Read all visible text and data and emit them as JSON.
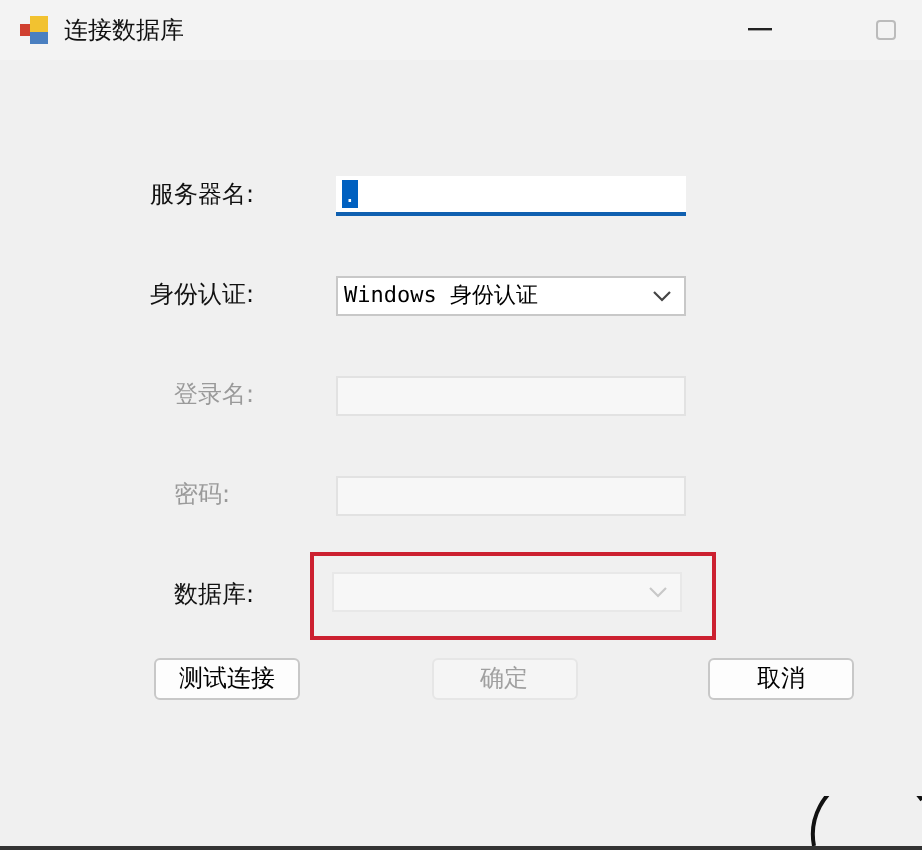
{
  "window": {
    "title": "连接数据库"
  },
  "fields": [
    {
      "label": "服务器名:",
      "label_greyed": false,
      "kind": "text",
      "value": ".",
      "disabled": false,
      "focused": true
    },
    {
      "label": "身份认证:",
      "label_greyed": false,
      "kind": "combo",
      "value": "Windows 身份认证",
      "disabled": false
    },
    {
      "label": "登录名:",
      "label_greyed": true,
      "kind": "text",
      "disabled": true
    },
    {
      "label": "密码:",
      "label_greyed": true,
      "kind": "text",
      "disabled": true
    },
    {
      "label": "数据库:",
      "label_greyed": false,
      "kind": "combo",
      "disabled": true,
      "highlighted": true
    }
  ],
  "buttons": [
    {
      "label": "测试连接",
      "disabled": false
    },
    {
      "label": "确定",
      "disabled": true
    },
    {
      "label": "取消",
      "disabled": false
    }
  ]
}
